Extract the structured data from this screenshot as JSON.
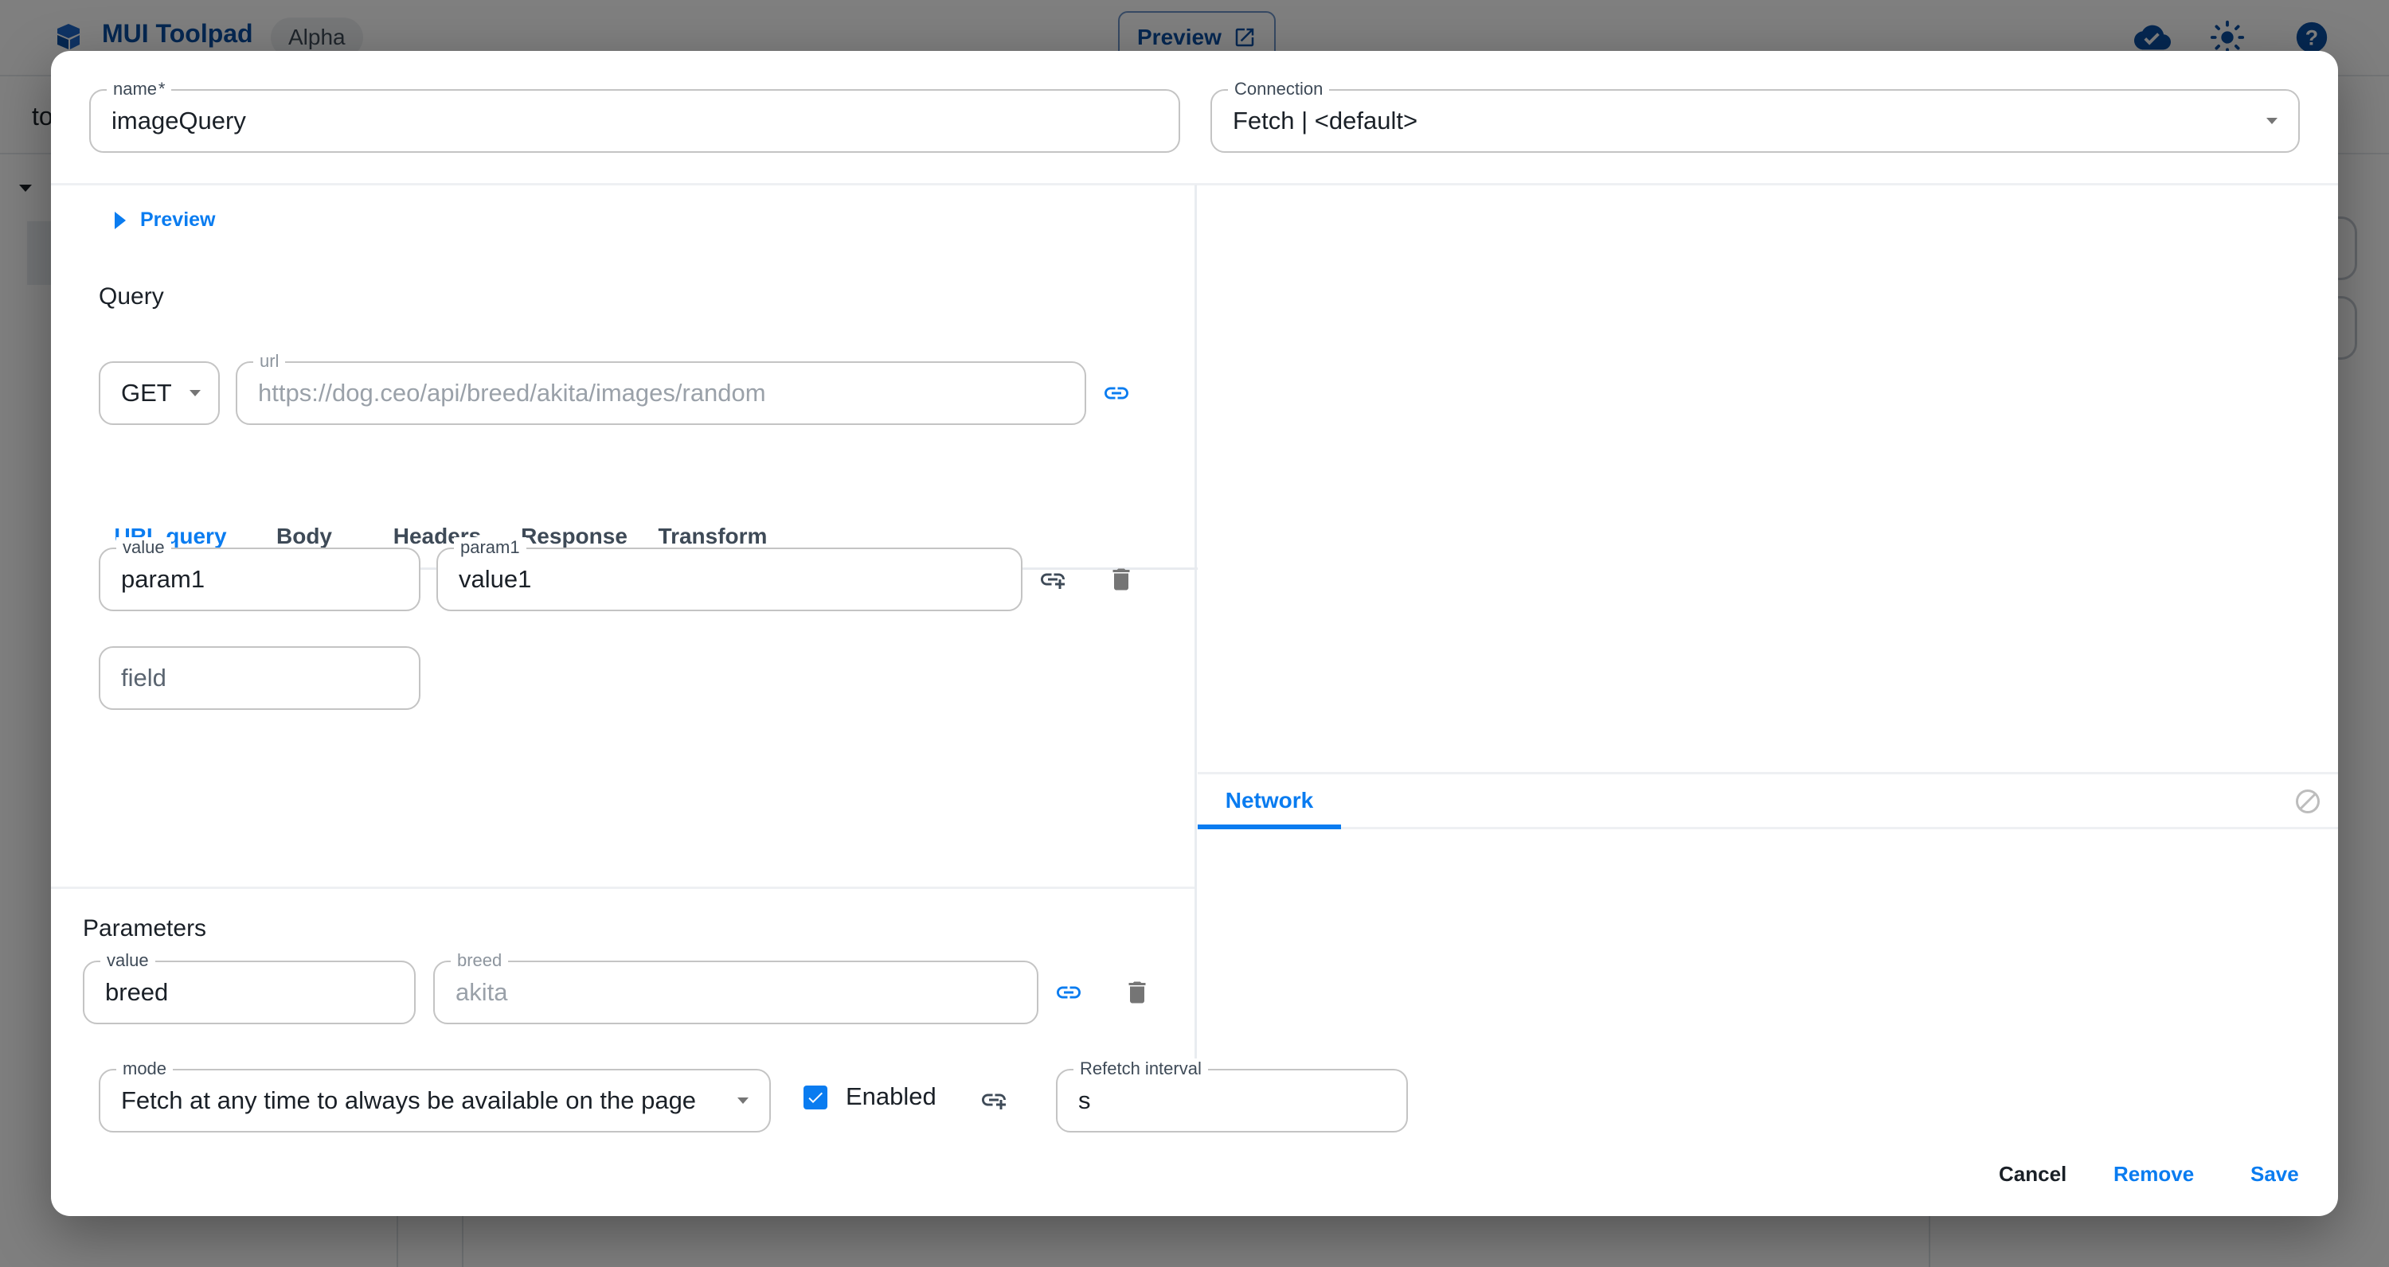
{
  "app": {
    "brand": "MUI Toolpad",
    "badge": "Alpha",
    "header_preview_label": "Preview",
    "page_title_partial": "to"
  },
  "dialog": {
    "name_field": {
      "label": "name",
      "required_marker": "*",
      "value": "imageQuery"
    },
    "connection_field": {
      "label": "Connection",
      "value": "Fetch | <default>"
    },
    "preview_button": "Preview",
    "query_title": "Query",
    "method_select": {
      "value": "GET"
    },
    "url_field": {
      "label": "url",
      "value": "https://dog.ceo/api/breed/akita/images/random"
    },
    "tabs": [
      {
        "label": "URL query",
        "active": true
      },
      {
        "label": "Body",
        "active": false
      },
      {
        "label": "Headers",
        "active": false
      },
      {
        "label": "Response",
        "active": false
      },
      {
        "label": "Transform",
        "active": false
      }
    ],
    "url_query_rows": [
      {
        "name_label": "value",
        "name_value": "param1",
        "value_label": "param1",
        "value_value": "value1"
      }
    ],
    "new_field_placeholder": "field",
    "parameters_title": "Parameters",
    "parameters_rows": [
      {
        "name_label": "value",
        "name_value": "breed",
        "value_label": "breed",
        "value_value": "akita"
      }
    ],
    "mode_select": {
      "label": "mode",
      "value": "Fetch at any time to always be available on the page"
    },
    "enabled_checkbox": {
      "label": "Enabled",
      "checked": true
    },
    "refetch_field": {
      "label": "Refetch interval",
      "value": "s"
    },
    "network_tab": "Network",
    "actions": {
      "cancel": "Cancel",
      "remove": "Remove",
      "save": "Save"
    }
  },
  "colors": {
    "primary": "#0a7cf0",
    "brand": "#0b4ea2",
    "text": "#1a2027",
    "icon_gray": "#757575"
  }
}
